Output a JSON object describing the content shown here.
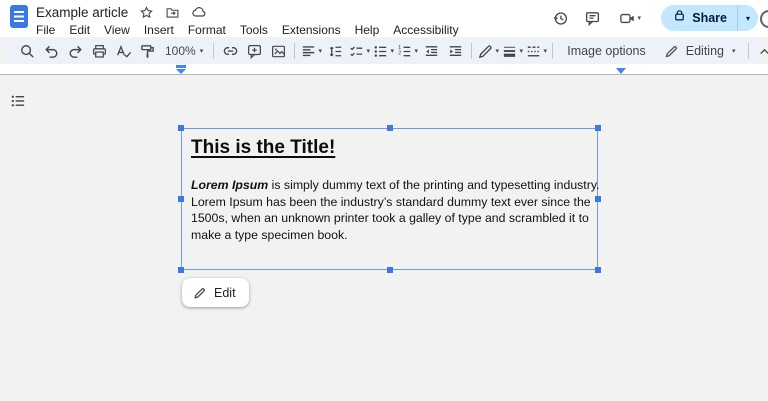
{
  "header": {
    "doc_title": "Example article",
    "menus": [
      "File",
      "Edit",
      "View",
      "Insert",
      "Format",
      "Tools",
      "Extensions",
      "Help",
      "Accessibility"
    ],
    "share": {
      "label": "Share"
    }
  },
  "toolbar": {
    "zoom_value": "100%",
    "image_options_label": "Image options",
    "mode_label": "Editing"
  },
  "doc": {
    "title": "This is the Title!",
    "para_line1_bold": "Lorem Ipsum",
    "para_line1_rest": " is simply dummy text of the printing and typesetting industry.",
    "para_line2": "Lorem Ipsum has been the industry’s standard dummy text ever since the",
    "para_line3": "1500s, when an unknown printer took a galley of type and scrambled it to",
    "para_line4": "make a type specimen book.",
    "edit_label": "Edit"
  },
  "colors": {
    "accent_blue": "#4285f4",
    "share_pill": "#c2e7ff",
    "toolbar_bg": "#edf2fa",
    "canvas_bg": "#f2f2f2",
    "icon_gray": "#444746"
  }
}
